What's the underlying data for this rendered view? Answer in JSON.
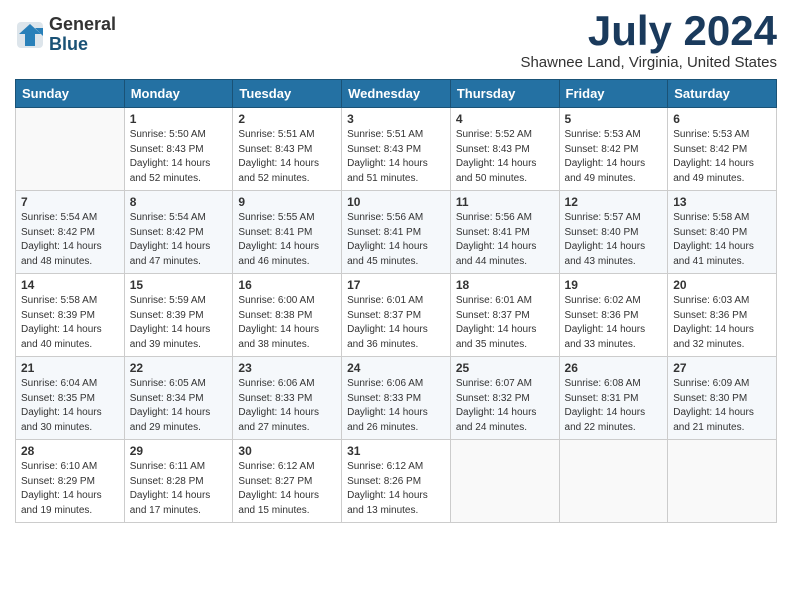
{
  "header": {
    "logo_general": "General",
    "logo_blue": "Blue",
    "month_title": "July 2024",
    "location": "Shawnee Land, Virginia, United States"
  },
  "calendar": {
    "days_of_week": [
      "Sunday",
      "Monday",
      "Tuesday",
      "Wednesday",
      "Thursday",
      "Friday",
      "Saturday"
    ],
    "weeks": [
      [
        {
          "day": "",
          "info": ""
        },
        {
          "day": "1",
          "info": "Sunrise: 5:50 AM\nSunset: 8:43 PM\nDaylight: 14 hours\nand 52 minutes."
        },
        {
          "day": "2",
          "info": "Sunrise: 5:51 AM\nSunset: 8:43 PM\nDaylight: 14 hours\nand 52 minutes."
        },
        {
          "day": "3",
          "info": "Sunrise: 5:51 AM\nSunset: 8:43 PM\nDaylight: 14 hours\nand 51 minutes."
        },
        {
          "day": "4",
          "info": "Sunrise: 5:52 AM\nSunset: 8:43 PM\nDaylight: 14 hours\nand 50 minutes."
        },
        {
          "day": "5",
          "info": "Sunrise: 5:53 AM\nSunset: 8:42 PM\nDaylight: 14 hours\nand 49 minutes."
        },
        {
          "day": "6",
          "info": "Sunrise: 5:53 AM\nSunset: 8:42 PM\nDaylight: 14 hours\nand 49 minutes."
        }
      ],
      [
        {
          "day": "7",
          "info": "Sunrise: 5:54 AM\nSunset: 8:42 PM\nDaylight: 14 hours\nand 48 minutes."
        },
        {
          "day": "8",
          "info": "Sunrise: 5:54 AM\nSunset: 8:42 PM\nDaylight: 14 hours\nand 47 minutes."
        },
        {
          "day": "9",
          "info": "Sunrise: 5:55 AM\nSunset: 8:41 PM\nDaylight: 14 hours\nand 46 minutes."
        },
        {
          "day": "10",
          "info": "Sunrise: 5:56 AM\nSunset: 8:41 PM\nDaylight: 14 hours\nand 45 minutes."
        },
        {
          "day": "11",
          "info": "Sunrise: 5:56 AM\nSunset: 8:41 PM\nDaylight: 14 hours\nand 44 minutes."
        },
        {
          "day": "12",
          "info": "Sunrise: 5:57 AM\nSunset: 8:40 PM\nDaylight: 14 hours\nand 43 minutes."
        },
        {
          "day": "13",
          "info": "Sunrise: 5:58 AM\nSunset: 8:40 PM\nDaylight: 14 hours\nand 41 minutes."
        }
      ],
      [
        {
          "day": "14",
          "info": "Sunrise: 5:58 AM\nSunset: 8:39 PM\nDaylight: 14 hours\nand 40 minutes."
        },
        {
          "day": "15",
          "info": "Sunrise: 5:59 AM\nSunset: 8:39 PM\nDaylight: 14 hours\nand 39 minutes."
        },
        {
          "day": "16",
          "info": "Sunrise: 6:00 AM\nSunset: 8:38 PM\nDaylight: 14 hours\nand 38 minutes."
        },
        {
          "day": "17",
          "info": "Sunrise: 6:01 AM\nSunset: 8:37 PM\nDaylight: 14 hours\nand 36 minutes."
        },
        {
          "day": "18",
          "info": "Sunrise: 6:01 AM\nSunset: 8:37 PM\nDaylight: 14 hours\nand 35 minutes."
        },
        {
          "day": "19",
          "info": "Sunrise: 6:02 AM\nSunset: 8:36 PM\nDaylight: 14 hours\nand 33 minutes."
        },
        {
          "day": "20",
          "info": "Sunrise: 6:03 AM\nSunset: 8:36 PM\nDaylight: 14 hours\nand 32 minutes."
        }
      ],
      [
        {
          "day": "21",
          "info": "Sunrise: 6:04 AM\nSunset: 8:35 PM\nDaylight: 14 hours\nand 30 minutes."
        },
        {
          "day": "22",
          "info": "Sunrise: 6:05 AM\nSunset: 8:34 PM\nDaylight: 14 hours\nand 29 minutes."
        },
        {
          "day": "23",
          "info": "Sunrise: 6:06 AM\nSunset: 8:33 PM\nDaylight: 14 hours\nand 27 minutes."
        },
        {
          "day": "24",
          "info": "Sunrise: 6:06 AM\nSunset: 8:33 PM\nDaylight: 14 hours\nand 26 minutes."
        },
        {
          "day": "25",
          "info": "Sunrise: 6:07 AM\nSunset: 8:32 PM\nDaylight: 14 hours\nand 24 minutes."
        },
        {
          "day": "26",
          "info": "Sunrise: 6:08 AM\nSunset: 8:31 PM\nDaylight: 14 hours\nand 22 minutes."
        },
        {
          "day": "27",
          "info": "Sunrise: 6:09 AM\nSunset: 8:30 PM\nDaylight: 14 hours\nand 21 minutes."
        }
      ],
      [
        {
          "day": "28",
          "info": "Sunrise: 6:10 AM\nSunset: 8:29 PM\nDaylight: 14 hours\nand 19 minutes."
        },
        {
          "day": "29",
          "info": "Sunrise: 6:11 AM\nSunset: 8:28 PM\nDaylight: 14 hours\nand 17 minutes."
        },
        {
          "day": "30",
          "info": "Sunrise: 6:12 AM\nSunset: 8:27 PM\nDaylight: 14 hours\nand 15 minutes."
        },
        {
          "day": "31",
          "info": "Sunrise: 6:12 AM\nSunset: 8:26 PM\nDaylight: 14 hours\nand 13 minutes."
        },
        {
          "day": "",
          "info": ""
        },
        {
          "day": "",
          "info": ""
        },
        {
          "day": "",
          "info": ""
        }
      ]
    ]
  }
}
